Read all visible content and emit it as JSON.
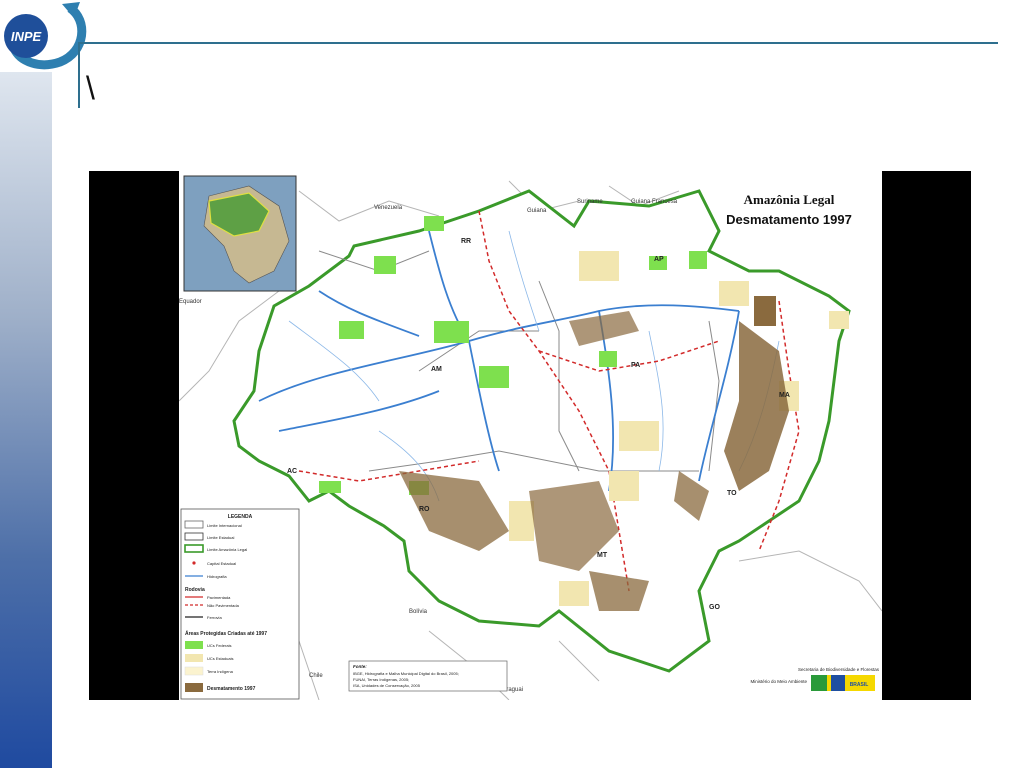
{
  "slide": {
    "title": "\\",
    "logo_text": "INPE"
  },
  "map": {
    "title": "Amazônia Legal",
    "subtitle": "Desmatamento 1997",
    "country_labels": [
      "Venezuela",
      "Guiana",
      "Suriname",
      "Guiana Francesa",
      "Equador",
      "Bolívia",
      "Chile",
      "Paraguai"
    ],
    "state_labels": [
      "RR",
      "AP",
      "AM",
      "PA",
      "MA",
      "AC",
      "RO",
      "MT",
      "TO",
      "GO"
    ],
    "legend": {
      "heading": "LEGENDA",
      "items": [
        "Limite Internacional",
        "Limite Estadual",
        "Limite Amazônia Legal",
        "Capital Estadual",
        "Hidrografia"
      ],
      "road_heading": "Rodovia",
      "road_items": [
        "Pavimentada",
        "Não Pavimentada",
        "Ferrovia"
      ],
      "areas_heading": "Áreas Protegidas Criadas até 1997",
      "area_items": [
        "UCs Federais",
        "UCs Estaduais",
        "Terra Indígena"
      ],
      "deforestation_label": "Desmatamento 1997"
    },
    "sources": {
      "heading": "Fonte:",
      "lines": [
        "IBGE, Hidrografia e Malha Municipal Digital do Brasil, 2005;",
        "FUNAI, Terras Indígenas, 2005;",
        "ISA, Unidades de Conservação, 2005"
      ]
    },
    "credits": {
      "secretariat": "Secretaria de Biodiversidade e Florestas",
      "ministry": "Ministério do Meio Ambiente",
      "govt": "BRASIL"
    },
    "colors": {
      "boundary_amazon": "#3a9a2a",
      "federal_uc": "#7ee04e",
      "state_uc": "#f2e6b0",
      "indigenous": "#fbf3cf",
      "deforestation": "#8a6a3e",
      "river": "#3b7fd0",
      "road": "#d22a2a"
    }
  }
}
